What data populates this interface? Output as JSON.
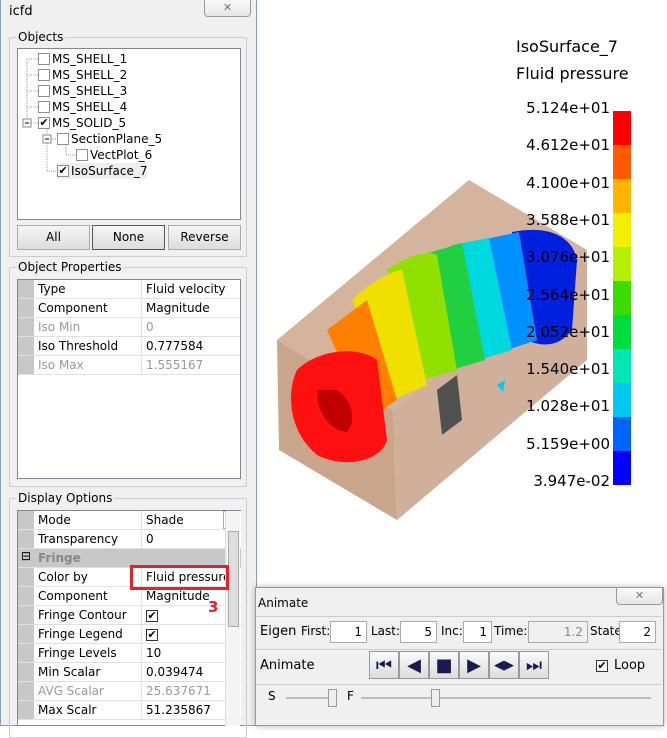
{
  "window": {
    "title": "icfd",
    "close": "✕"
  },
  "objects": {
    "label": "Objects",
    "items": [
      {
        "label": "MS_SHELL_1",
        "checked": false
      },
      {
        "label": "MS_SHELL_2",
        "checked": false
      },
      {
        "label": "MS_SHELL_3",
        "checked": false
      },
      {
        "label": "MS_SHELL_4",
        "checked": false
      },
      {
        "label": "MS_SOLID_5",
        "checked": true
      },
      {
        "label": "SectionPlane_5",
        "checked": false
      },
      {
        "label": "VectPlot_6",
        "checked": false
      },
      {
        "label": "IsoSurface_7",
        "checked": true
      }
    ],
    "buttons": {
      "all": "All",
      "none": "None",
      "reverse": "Reverse"
    }
  },
  "properties": {
    "label": "Object Properties",
    "rows": [
      {
        "k": "Type",
        "v": "Fluid velocity"
      },
      {
        "k": "Component",
        "v": "Magnitude"
      },
      {
        "k": "Iso Min",
        "v": "0"
      },
      {
        "k": "Iso Threshold",
        "v": "0.777584"
      },
      {
        "k": "Iso Max",
        "v": "1.555167"
      }
    ]
  },
  "display": {
    "label": "Display Options",
    "mode_k": "Mode",
    "mode_v": "Shade",
    "transp_k": "Transparency",
    "transp_v": "0",
    "fringe": "Fringe",
    "rows": [
      {
        "k": "Color by",
        "v": "Fluid pressure"
      },
      {
        "k": "Component",
        "v": "Magnitude"
      },
      {
        "k": "Fringe Contour",
        "v": "✔"
      },
      {
        "k": "Fringe Legend",
        "v": "✔"
      },
      {
        "k": "Fringe Levels",
        "v": "10"
      },
      {
        "k": "Min Scalar",
        "v": "0.039474"
      },
      {
        "k": "AVG Scalar",
        "v": "25.637671"
      },
      {
        "k": "Max Scalr",
        "v": "51.235867"
      }
    ],
    "annotation": "3"
  },
  "legend": {
    "title": "IsoSurface_7",
    "subtitle": "Fluid pressure",
    "labels": [
      "5.124e+01",
      "4.612e+01",
      "4.100e+01",
      "3.588e+01",
      "3.076e+01",
      "2.564e+01",
      "2.052e+01",
      "1.540e+01",
      "1.028e+01",
      "5.159e+00",
      "3.947e-02"
    ],
    "colors": [
      "#ff0000",
      "#ff5a00",
      "#ffb400",
      "#f0f000",
      "#b4f000",
      "#3cdc00",
      "#00dc3c",
      "#00e6b4",
      "#00c8f0",
      "#0064ff",
      "#0000ff"
    ]
  },
  "animate": {
    "title": "Animate",
    "eigen": "Eigen",
    "first_l": "First:",
    "first": "1",
    "last_l": "Last:",
    "last": "5",
    "inc_l": "Inc:",
    "inc": "1",
    "time_l": "Time:",
    "time": "1.2",
    "state_l": "State:",
    "state": "2",
    "animate": "Animate",
    "loop": "Loop",
    "s": "S",
    "f": "F"
  }
}
